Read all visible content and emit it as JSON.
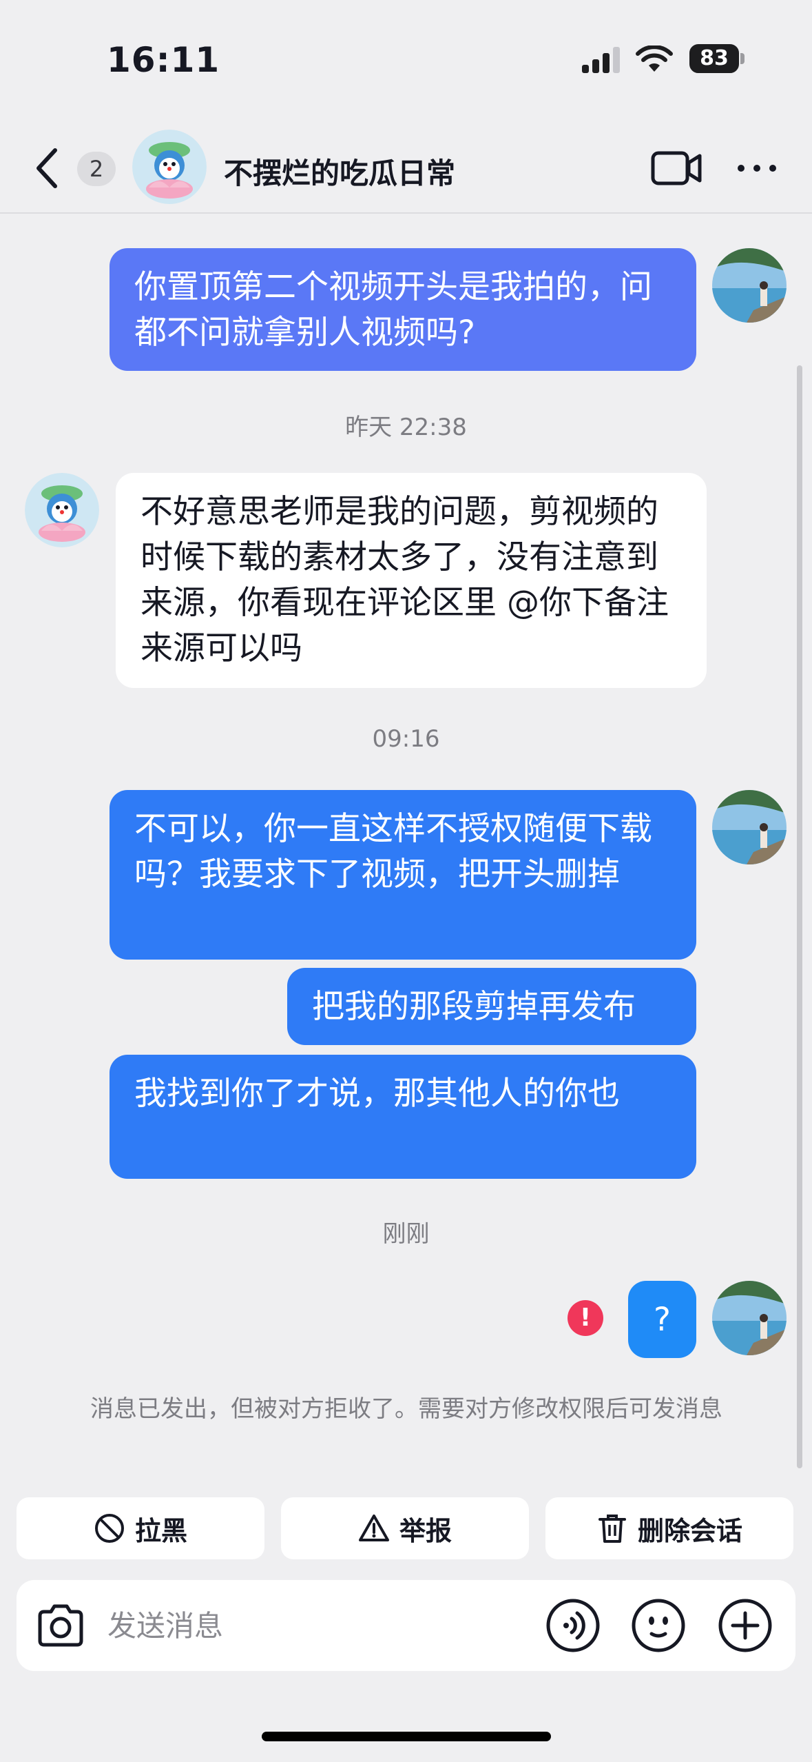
{
  "status_bar": {
    "time": "16:11",
    "battery": "83"
  },
  "header": {
    "unread_count": "2",
    "title": "不摆烂的吃瓜日常",
    "icons": [
      "chevron-left-icon",
      "video-call-icon",
      "more-icon"
    ]
  },
  "messages": [
    {
      "sender": "me",
      "text": "你置顶第二个视频开头是我拍的，问都不问就拿别人视频吗?",
      "color": "#5a78f6"
    },
    {
      "type": "timestamp",
      "text": "昨天 22:38"
    },
    {
      "sender": "them",
      "text": "不好意思老师是我的问题，剪视频的时候下载的素材太多了，没有注意到来源，你看现在评论区里 @你下备注来源可以吗"
    },
    {
      "type": "timestamp",
      "text": "09:16"
    },
    {
      "sender": "me",
      "text": "不可以，你一直这样不授权随便下载吗？我要求下了视频，把开头删掉",
      "color": "#2f7bf6"
    },
    {
      "sender": "me",
      "text": "把我的那段剪掉再发布",
      "color": "#2f7bf6"
    },
    {
      "sender": "me",
      "text": "我找到你了才说，那其他人的你也",
      "color": "#2f7bf6"
    },
    {
      "type": "timestamp",
      "text": "刚刚"
    },
    {
      "sender": "me",
      "text": "?",
      "status": "failed",
      "color": "#1f8bf7"
    }
  ],
  "error_mark": "!",
  "notice": "消息已发出，但被对方拒收了。需要对方修改权限后可发消息",
  "actions": {
    "block": "拉黑",
    "report": "举报",
    "delete": "删除会话"
  },
  "input": {
    "placeholder": "发送消息"
  },
  "colors": {
    "background": "#efeff1",
    "error": "#f0375a"
  }
}
